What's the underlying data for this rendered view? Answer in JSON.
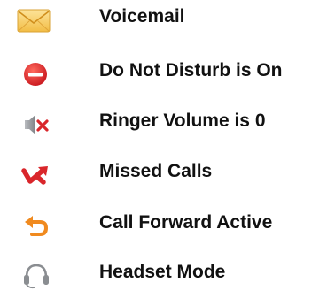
{
  "legend": {
    "items": [
      {
        "icon": "envelope-icon",
        "label": "Voicemail"
      },
      {
        "icon": "do-not-disturb-icon",
        "label": "Do Not Disturb is On"
      },
      {
        "icon": "speaker-muted-icon",
        "label": "Ringer Volume is 0"
      },
      {
        "icon": "missed-call-arrow-icon",
        "label": "Missed Calls"
      },
      {
        "icon": "forward-arrow-icon",
        "label": "Call Forward Active"
      },
      {
        "icon": "headset-icon",
        "label": "Headset Mode"
      }
    ]
  },
  "colors": {
    "envelope": "#f6c85a",
    "do_not_disturb": "#e0282e",
    "mute_x": "#d9262b",
    "missed_call": "#d9262b",
    "forward": "#f08a1f",
    "headset": "#8a8d91",
    "text": "#111111"
  }
}
